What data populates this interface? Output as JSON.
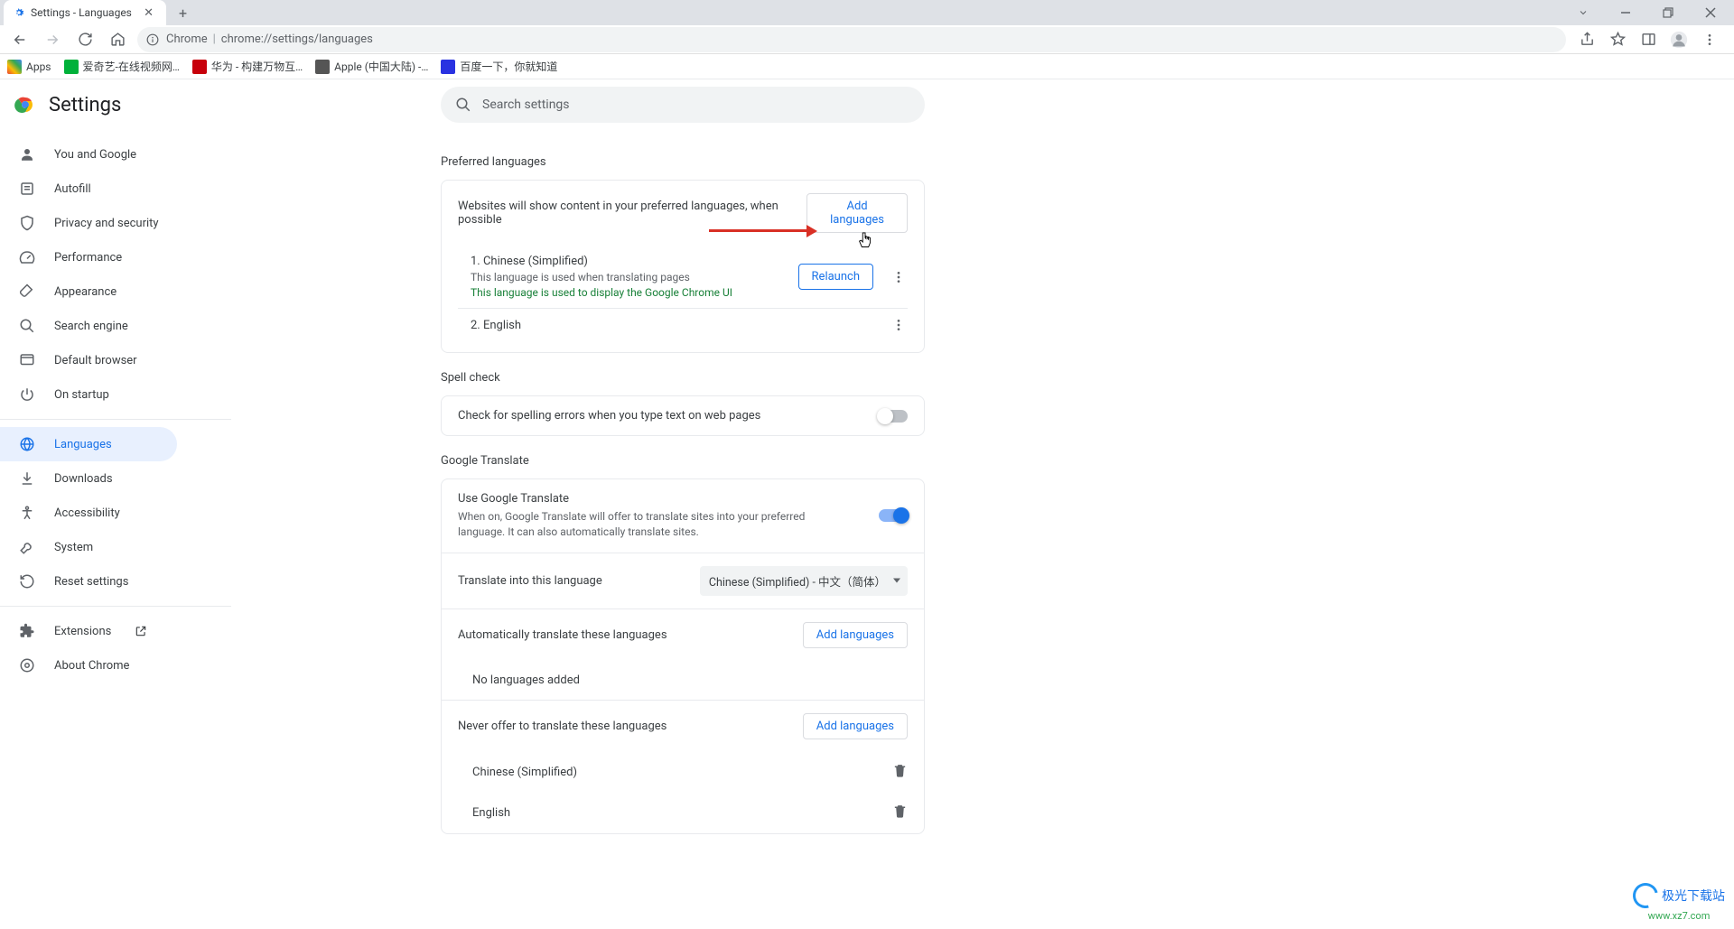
{
  "tab": {
    "title": "Settings - Languages"
  },
  "addr": {
    "origin": "Chrome",
    "url": "chrome://settings/languages"
  },
  "bookmarks": [
    {
      "label": "Apps",
      "color": "#ea4335"
    },
    {
      "label": "爱奇艺-在线视频网…",
      "color": "#00b13a"
    },
    {
      "label": "华为 - 构建万物互…",
      "color": "#c7000b"
    },
    {
      "label": "Apple (中国大陆) -…",
      "color": "#a2aaad"
    },
    {
      "label": "百度一下，你就知道",
      "color": "#2932e1"
    }
  ],
  "header": {
    "title": "Settings"
  },
  "search_placeholder": "Search settings",
  "sidebar": [
    {
      "label": "You and Google",
      "icon": "person"
    },
    {
      "label": "Autofill",
      "icon": "autofill"
    },
    {
      "label": "Privacy and security",
      "icon": "shield"
    },
    {
      "label": "Performance",
      "icon": "speed"
    },
    {
      "label": "Appearance",
      "icon": "brush"
    },
    {
      "label": "Search engine",
      "icon": "search"
    },
    {
      "label": "Default browser",
      "icon": "browser"
    },
    {
      "label": "On startup",
      "icon": "power"
    },
    {
      "label": "Languages",
      "icon": "globe",
      "active": true
    },
    {
      "label": "Downloads",
      "icon": "download"
    },
    {
      "label": "Accessibility",
      "icon": "accessibility"
    },
    {
      "label": "System",
      "icon": "wrench"
    },
    {
      "label": "Reset settings",
      "icon": "reset"
    },
    {
      "label": "Extensions",
      "icon": "ext",
      "external": true
    },
    {
      "label": "About Chrome",
      "icon": "info"
    }
  ],
  "preferred": {
    "section": "Preferred languages",
    "desc": "Websites will show content in your preferred languages, when possible",
    "add": "Add languages",
    "lang1": {
      "title": "1. Chinese (Simplified)",
      "sub1": "This language is used when translating pages",
      "sub2": "This language is used to display the Google Chrome UI",
      "relaunch": "Relaunch"
    },
    "lang2": {
      "title": "2. English"
    }
  },
  "spell": {
    "section": "Spell check",
    "desc": "Check for spelling errors when you type text on web pages"
  },
  "translate": {
    "section": "Google Translate",
    "use_title": "Use Google Translate",
    "use_desc": "When on, Google Translate will offer to translate sites into your preferred language. It can also automatically translate sites.",
    "into_label": "Translate into this language",
    "into_value": "Chinese (Simplified) - 中文（简体）",
    "auto_label": "Automatically translate these languages",
    "add": "Add languages",
    "none": "No languages added",
    "never_label": "Never offer to translate these languages",
    "never1": "Chinese (Simplified)",
    "never2": "English"
  },
  "watermark": {
    "text": "极光下载站",
    "url": "www.xz7.com"
  }
}
